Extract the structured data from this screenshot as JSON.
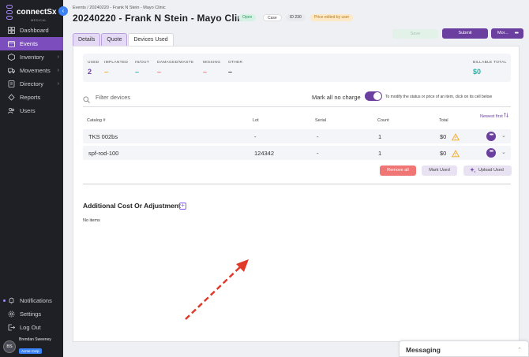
{
  "app": {
    "logo_text": "connectSx",
    "logo_sub": "MEDICAL"
  },
  "sidebar": {
    "items": [
      {
        "label": "Dashboard",
        "icon": "dashboard-icon"
      },
      {
        "label": "Events",
        "icon": "calendar-icon",
        "active": true
      },
      {
        "label": "Inventory",
        "icon": "box-icon",
        "chevron": true
      },
      {
        "label": "Movements",
        "icon": "truck-icon",
        "chevron": true
      },
      {
        "label": "Directory",
        "icon": "directory-icon",
        "chevron": true
      },
      {
        "label": "Reports",
        "icon": "reports-icon"
      },
      {
        "label": "Users",
        "icon": "users-icon"
      }
    ],
    "bottom": [
      {
        "label": "Notifications",
        "icon": "bell-icon"
      },
      {
        "label": "Settings",
        "icon": "gear-icon"
      },
      {
        "label": "Log Out",
        "icon": "logout-icon"
      }
    ],
    "user": {
      "initials": "BS",
      "name": "Brendan Sweeney",
      "org": "Acme Corp"
    }
  },
  "header": {
    "breadcrumb": "Events / 20240220 - Frank N Stein - Mayo Clinic",
    "title": "20240220 - Frank N Stein - Mayo Clinic",
    "badges": {
      "status": "Open",
      "type": "Case",
      "id": "ID 230",
      "note": "Price edited by user"
    },
    "tabs": [
      "Details",
      "Quote",
      "Devices Used"
    ],
    "save_label": "Save",
    "submit_label": "Submit",
    "more_label": "Mor...",
    "more_dots": "•••"
  },
  "stats": {
    "used": {
      "label": "USED",
      "value": "2"
    },
    "implanted": {
      "label": "IMPLANTED",
      "value": "–"
    },
    "in_out": {
      "label": "IN/OUT",
      "value": "–"
    },
    "damaged": {
      "label": "DAMAGED/WASTE",
      "value": "–"
    },
    "missing": {
      "label": "MISSING",
      "value": "–"
    },
    "other": {
      "label": "OTHER",
      "value": "–"
    },
    "billable": {
      "label": "BILLABLE TOTAL",
      "value": "$0"
    }
  },
  "filter": {
    "placeholder": "Filter devices",
    "toggle_label": "Mark all no charge",
    "hint": "To modify the status or price of an item, click on its cell below"
  },
  "table": {
    "sort_label": "Newest first",
    "columns": [
      "Catalog #",
      "Lot",
      "Serial",
      "Count",
      "Total"
    ],
    "rows": [
      {
        "catalog": "TKS 002bs",
        "lot": "-",
        "serial": "-",
        "count": "1",
        "total": "$0"
      },
      {
        "catalog": "spf-rod-100",
        "lot": "124342",
        "serial": "-",
        "count": "1",
        "total": "$0"
      }
    ],
    "row_more": "•••",
    "chevron": "⌄"
  },
  "actions": {
    "remove_all": "Remove all",
    "mark_used": "Mark Used",
    "upload_used": "Upload Used"
  },
  "additional": {
    "title": "Additional Cost Or Adjustment",
    "add": "+",
    "empty": "No items"
  },
  "messaging": {
    "title": "Messaging",
    "chevron": "⌃"
  },
  "colors": {
    "accent": "#6b3fa0",
    "sidebar_bg": "#1f2026",
    "active_nav": "#7c4dbd",
    "open_badge": "#d6f2e4",
    "remove_btn": "#f07575",
    "billable": "#1fb3a8",
    "used": "#6b3fa0",
    "implanted": "#f5a623",
    "in_out": "#1fb3a8",
    "damaged": "#f07575",
    "missing": "#f07575",
    "arrow": "#e03a2b"
  }
}
